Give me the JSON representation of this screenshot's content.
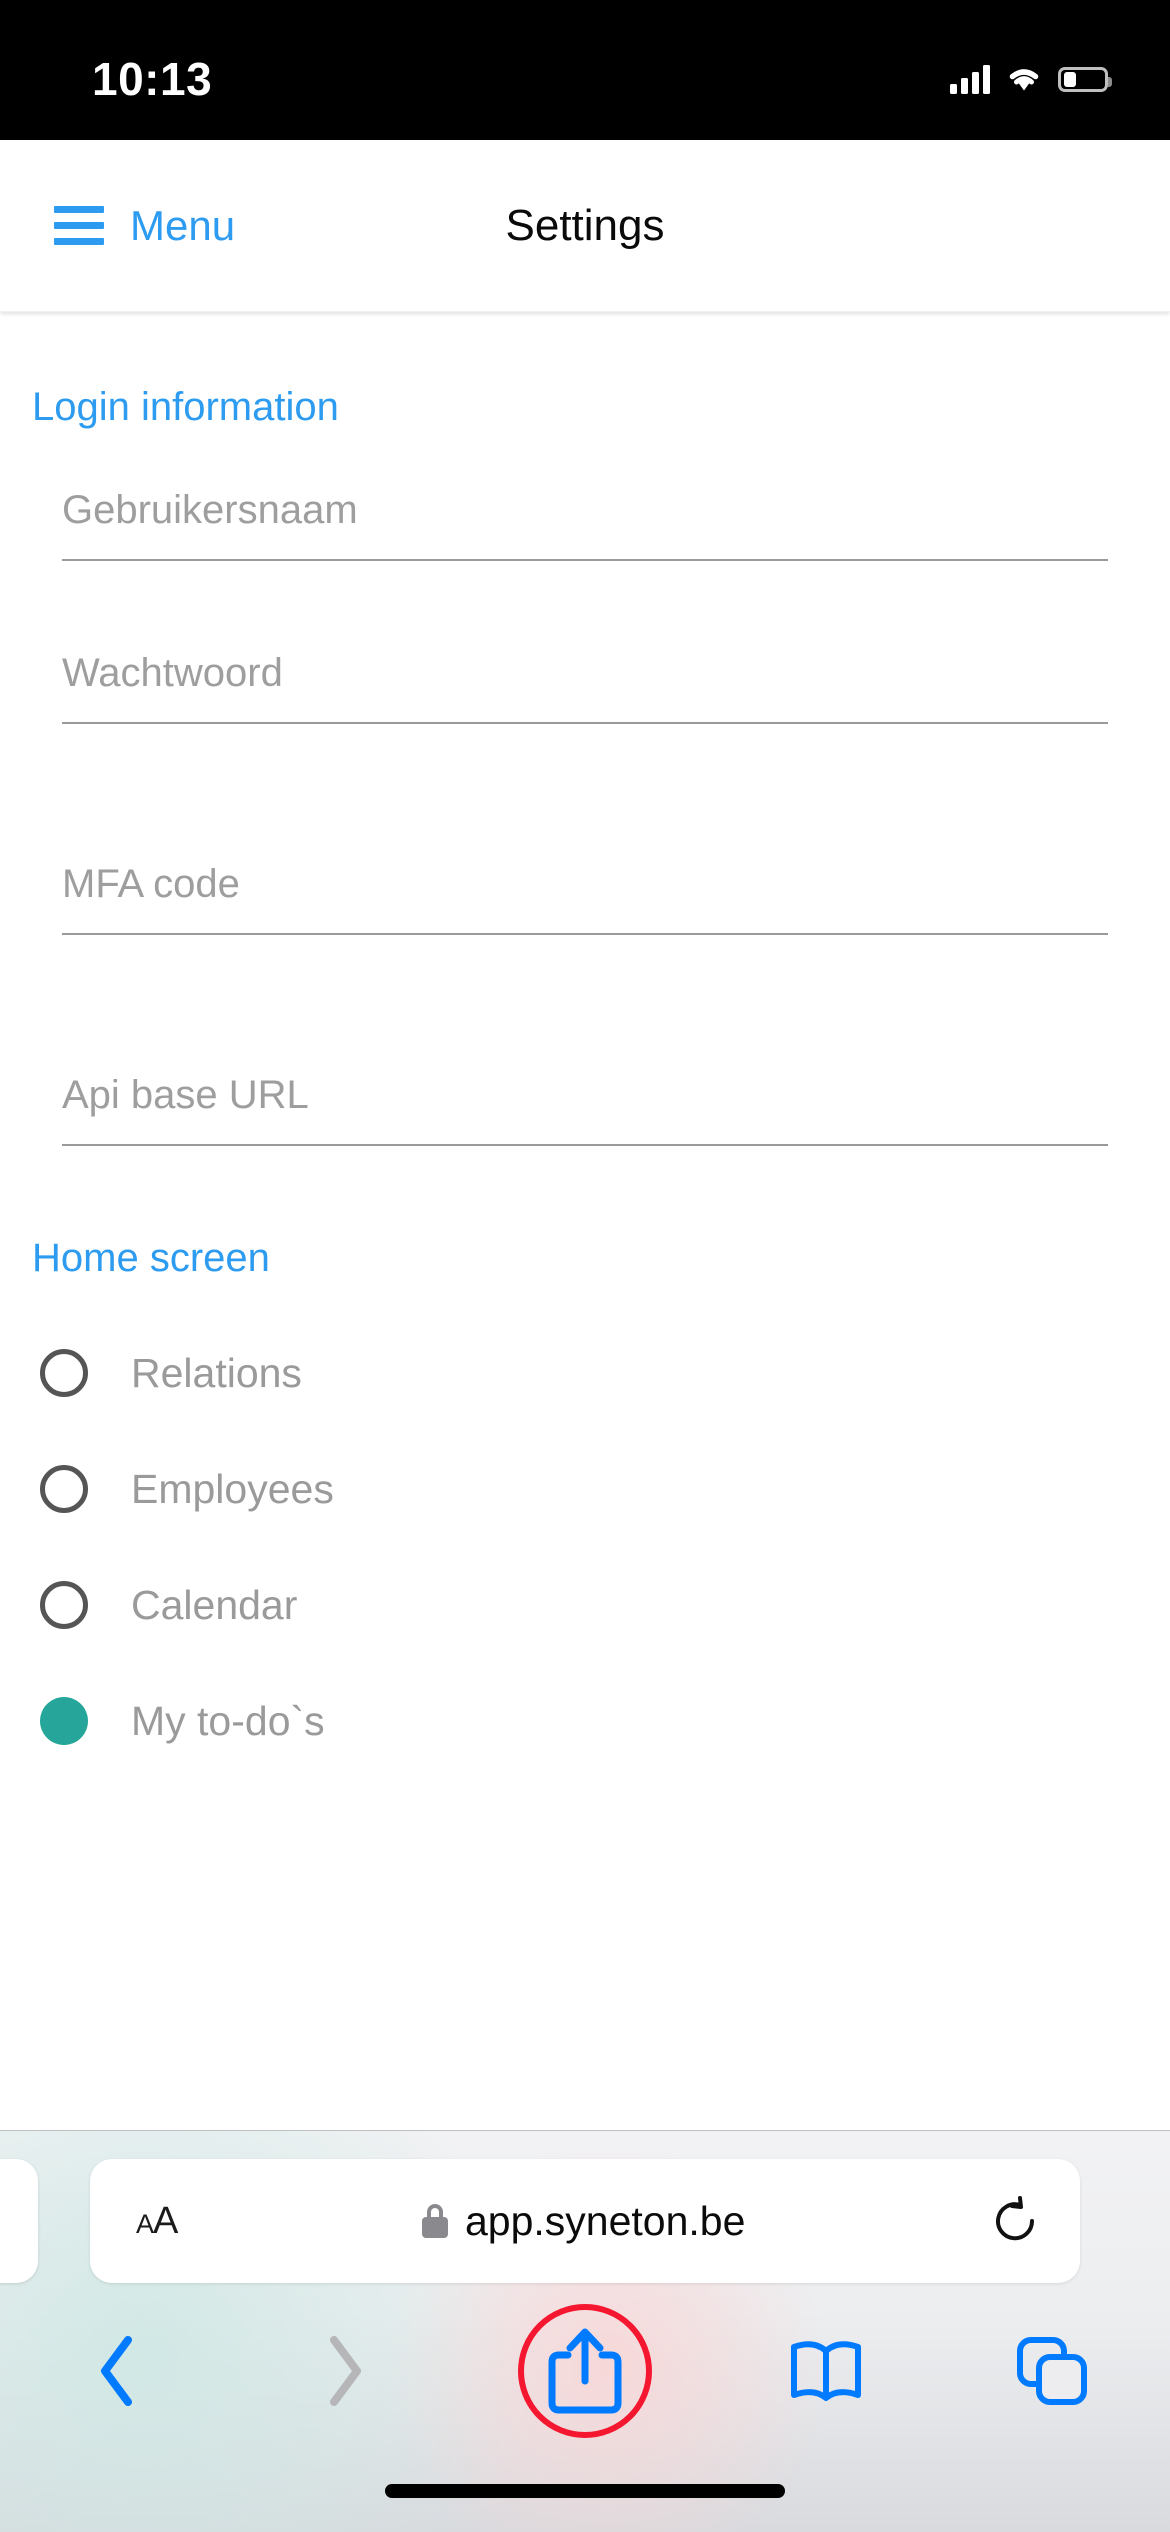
{
  "status_bar": {
    "time": "10:13",
    "signal_icon": "cellular-signal-icon",
    "wifi_icon": "wifi-icon",
    "battery_icon": "battery-low-icon"
  },
  "navbar": {
    "menu_label": "Menu",
    "menu_icon": "hamburger-menu-icon",
    "title": "Settings"
  },
  "page": {
    "login_section": {
      "heading": "Login information",
      "fields": [
        {
          "name": "username",
          "placeholder": "Gebruikersnaam",
          "value": ""
        },
        {
          "name": "password",
          "placeholder": "Wachtwoord",
          "value": ""
        },
        {
          "name": "mfa",
          "placeholder": "MFA code",
          "value": ""
        },
        {
          "name": "api_url",
          "placeholder": "Api base URL",
          "value": ""
        }
      ]
    },
    "home_section": {
      "heading": "Home screen",
      "options": [
        {
          "label": "Relations",
          "selected": false
        },
        {
          "label": "Employees",
          "selected": false
        },
        {
          "label": "Calendar",
          "selected": false
        },
        {
          "label": "My to-do`s",
          "selected": true
        }
      ]
    }
  },
  "browser": {
    "text_size_label": "AA",
    "lock_icon": "lock-icon",
    "url": "app.syneton.be",
    "reload_icon": "reload-icon",
    "toolbar": {
      "back_icon": "chevron-left-icon",
      "forward_icon": "chevron-right-icon",
      "share_icon": "share-icon",
      "bookmarks_icon": "book-icon",
      "tabs_icon": "tabs-icon"
    }
  },
  "colors": {
    "accent_blue": "#2d9cf0",
    "safari_blue": "#007aff",
    "selected_teal": "#26a69a",
    "annotation_red": "#f5162f",
    "placeholder_gray": "#9e9e9e"
  }
}
